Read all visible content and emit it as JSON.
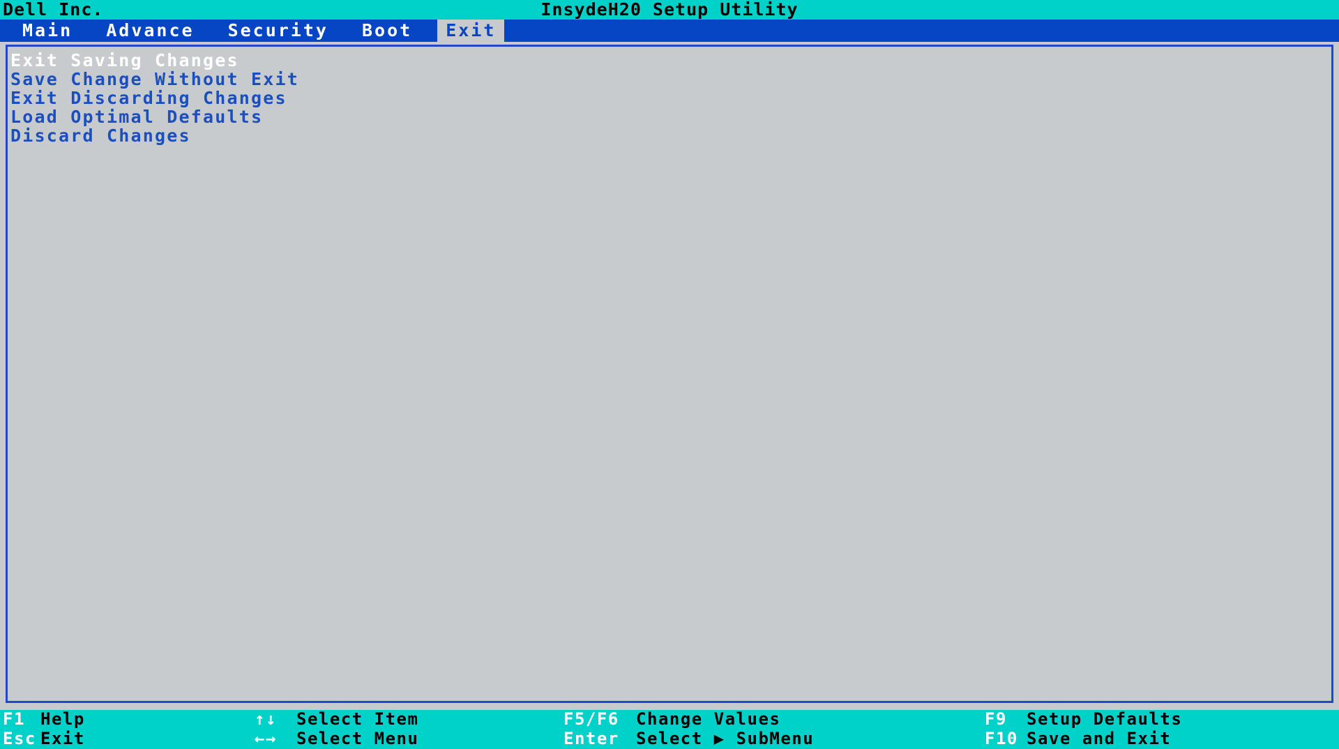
{
  "title_bar": {
    "vendor": "Dell Inc.",
    "utility_title": "InsydeH20 Setup Utility",
    "background_color": "#00d2ca",
    "text_color": "#000000"
  },
  "menu_bar": {
    "background_color": "#0645c4",
    "text_color": "#ffffff",
    "active_background_color": "#c8cbcd",
    "active_text_color": "#0645c4",
    "tabs": [
      {
        "label": "Main",
        "active": false
      },
      {
        "label": "Advance",
        "active": false
      },
      {
        "label": "Security",
        "active": false
      },
      {
        "label": "Boot",
        "active": false
      },
      {
        "label": "Exit",
        "active": true
      }
    ]
  },
  "content_panel": {
    "background_color": "#c8cbcd",
    "border_color": "#2048c8",
    "item_color": "#1b4fc0",
    "selected_item_color": "#ffffff",
    "options": [
      {
        "label": "Exit Saving Changes",
        "selected": true
      },
      {
        "label": "Save Change Without Exit",
        "selected": false
      },
      {
        "label": "Exit Discarding Changes",
        "selected": false
      },
      {
        "label": "Load Optimal Defaults",
        "selected": false
      },
      {
        "label": "Discard Changes",
        "selected": false
      }
    ]
  },
  "footer": {
    "background_color": "#00d2ca",
    "key_color": "#ffffff",
    "description_color": "#000000",
    "columns": [
      {
        "rows": [
          {
            "key": "F1",
            "description": "Help"
          },
          {
            "key": "Esc",
            "description": "Exit"
          }
        ]
      },
      {
        "rows": [
          {
            "key": "↑↓",
            "description": "Select Item"
          },
          {
            "key": "←→",
            "description": "Select Menu"
          }
        ]
      },
      {
        "rows": [
          {
            "key": "F5/F6",
            "description": "Change Values"
          },
          {
            "key": "Enter",
            "description": "Select ▶ SubMenu"
          }
        ]
      },
      {
        "rows": [
          {
            "key": "F9",
            "description": "Setup Defaults"
          },
          {
            "key": "F10",
            "description": "Save and Exit"
          }
        ]
      }
    ]
  }
}
